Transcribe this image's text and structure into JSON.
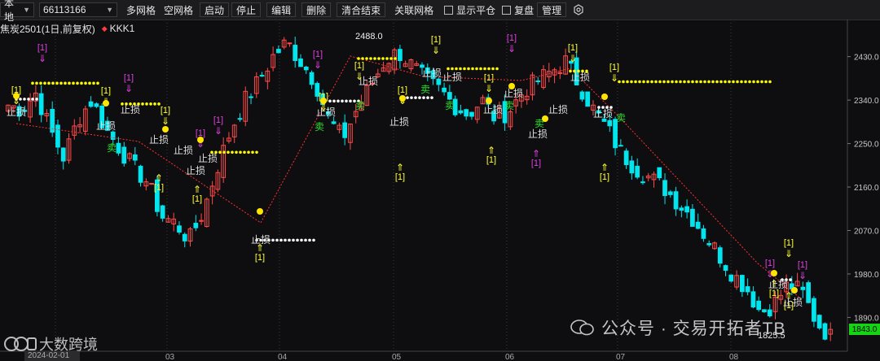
{
  "toolbar": {
    "account_select": "本地",
    "account_id": "66113166",
    "buttons": [
      "多网格",
      "空网格",
      "启动",
      "停止",
      "编辑",
      "删除",
      "清合结束",
      "关联网格"
    ],
    "checkbox_show_close": "显示平仓",
    "checkbox_review": "复盘",
    "manage": "管理"
  },
  "legend": {
    "symbol": "焦炭2501(1日,前复权)",
    "indicator": "KKK1"
  },
  "axis": {
    "y_labels": [
      "2430.0",
      "2340.0",
      "2250.0",
      "2160.0",
      "2070.0",
      "1980.0",
      "1890.0"
    ],
    "x_labels": [
      "2024-02-01",
      "03",
      "04",
      "05",
      "06",
      "07",
      "08"
    ],
    "high_label": "2488.0",
    "low_label": "1825.5",
    "last_price": "1843.0"
  },
  "annotations": {
    "signal": "[1]",
    "stop": "止损",
    "sell": "卖"
  },
  "watermark": "公众号 · 交易开拓者TB",
  "brand": "大数跨境",
  "colors": {
    "up": "#ff4a4a",
    "down": "#00e5ee",
    "yellow_dots": "#ffff00",
    "white_dots": "#ffffff",
    "magenta": "#e040e0",
    "green_text": "#22e022",
    "dashed_line": "#ff3030"
  },
  "chart_data": {
    "type": "candlestick",
    "ylim": [
      1820,
      2490
    ],
    "y_ticks": [
      2430,
      2340,
      2250,
      2160,
      2070,
      1980,
      1890
    ],
    "key_prices": {
      "high": 2488.0,
      "low": 1825.5,
      "last": 1843.0
    },
    "anchor_closes": [
      2330,
      2320,
      2355,
      2280,
      2220,
      2300,
      2340,
      2280,
      2240,
      2200,
      2170,
      2100,
      2085,
      2050,
      2110,
      2200,
      2280,
      2340,
      2380,
      2430,
      2460,
      2420,
      2380,
      2300,
      2260,
      2320,
      2370,
      2420,
      2440,
      2410,
      2380,
      2360,
      2330,
      2310,
      2340,
      2300,
      2320,
      2360,
      2380,
      2400,
      2420,
      2370,
      2320,
      2280,
      2230,
      2200,
      2180,
      2160,
      2130,
      2100,
      2060,
      2020,
      1980,
      1950,
      1900,
      1920,
      1960,
      1940,
      1880,
      1850
    ]
  }
}
